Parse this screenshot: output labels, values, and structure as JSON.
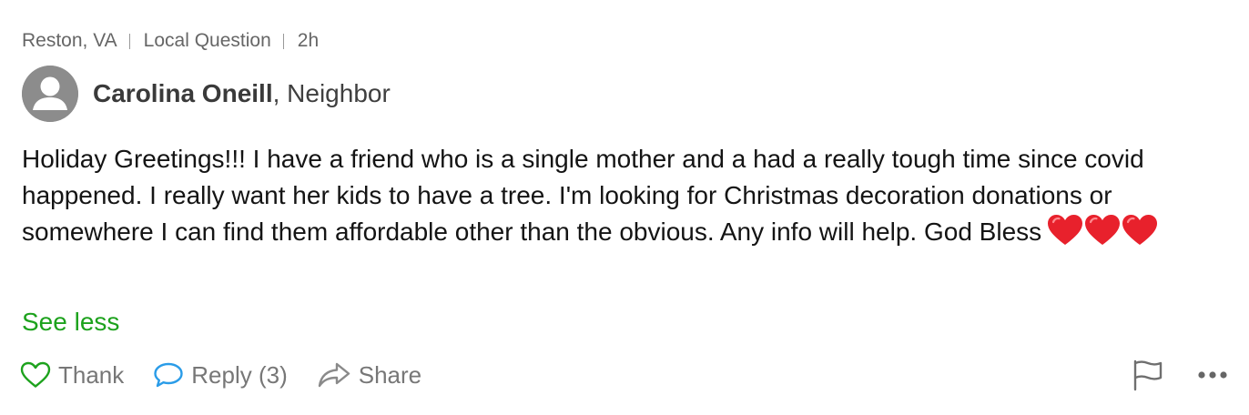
{
  "meta": {
    "location": "Reston, VA",
    "category": "Local Question",
    "age": "2h"
  },
  "author": {
    "name": "Carolina Oneill",
    "separator": ",",
    "role": "Neighbor",
    "avatar_icon": "default-avatar-icon"
  },
  "post": {
    "text": "Holiday Greetings!!! I have a friend who is a single mother and a had a really tough time since covid happened. I really want her kids to have a tree. I'm looking for Christmas decoration donations or somewhere I can find them affordable other than the obvious. Any info will help. God Bless",
    "emoji": [
      "red-heart-icon",
      "red-heart-icon",
      "red-heart-icon"
    ],
    "see_less_label": "See less"
  },
  "actions": {
    "thank_label": "Thank",
    "reply_label": "Reply (3)",
    "share_label": "Share",
    "flag_icon": "flag-icon",
    "more_icon": "more-dots-icon"
  },
  "colors": {
    "accent_green": "#1da21d",
    "reply_blue": "#2a9ce8",
    "thank_green": "#1da21d",
    "muted_text": "#777777"
  }
}
